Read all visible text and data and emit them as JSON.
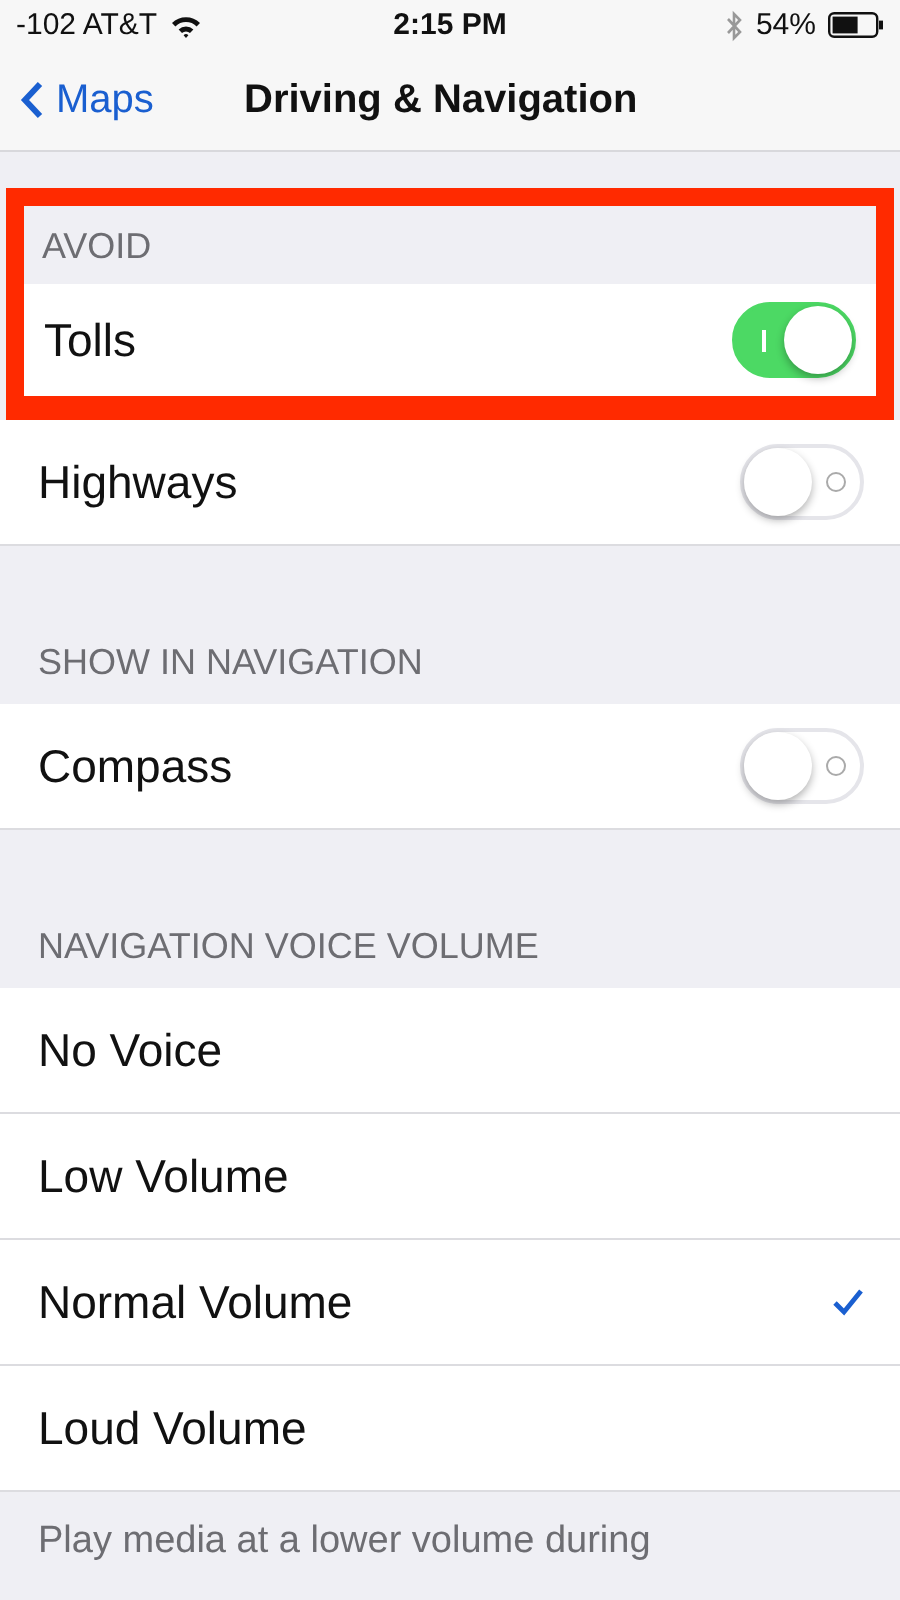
{
  "status_bar": {
    "carrier": "-102 AT&T",
    "time": "2:15 PM",
    "battery": "54%"
  },
  "nav_bar": {
    "back": "Maps",
    "title": "Driving & Navigation"
  },
  "sections": [
    {
      "header": "AVOID",
      "highlighted": true,
      "rows": [
        {
          "kind": "toggle",
          "label": "Tolls",
          "on": true,
          "highlighted": true
        },
        {
          "kind": "toggle",
          "label": "Highways",
          "on": false,
          "highlighted": false
        }
      ]
    },
    {
      "header": "SHOW IN NAVIGATION",
      "highlighted": false,
      "rows": [
        {
          "kind": "toggle",
          "label": "Compass",
          "on": false,
          "highlighted": false
        }
      ]
    },
    {
      "header": "NAVIGATION VOICE VOLUME",
      "highlighted": false,
      "rows": [
        {
          "kind": "choice",
          "label": "No Voice",
          "selected": false,
          "highlighted": false
        },
        {
          "kind": "choice",
          "label": "Low Volume",
          "selected": false,
          "highlighted": false
        },
        {
          "kind": "choice",
          "label": "Normal Volume",
          "selected": true,
          "highlighted": false
        },
        {
          "kind": "choice",
          "label": "Loud Volume",
          "selected": false,
          "highlighted": false
        }
      ]
    }
  ],
  "footer": "Play media at a lower volume during"
}
